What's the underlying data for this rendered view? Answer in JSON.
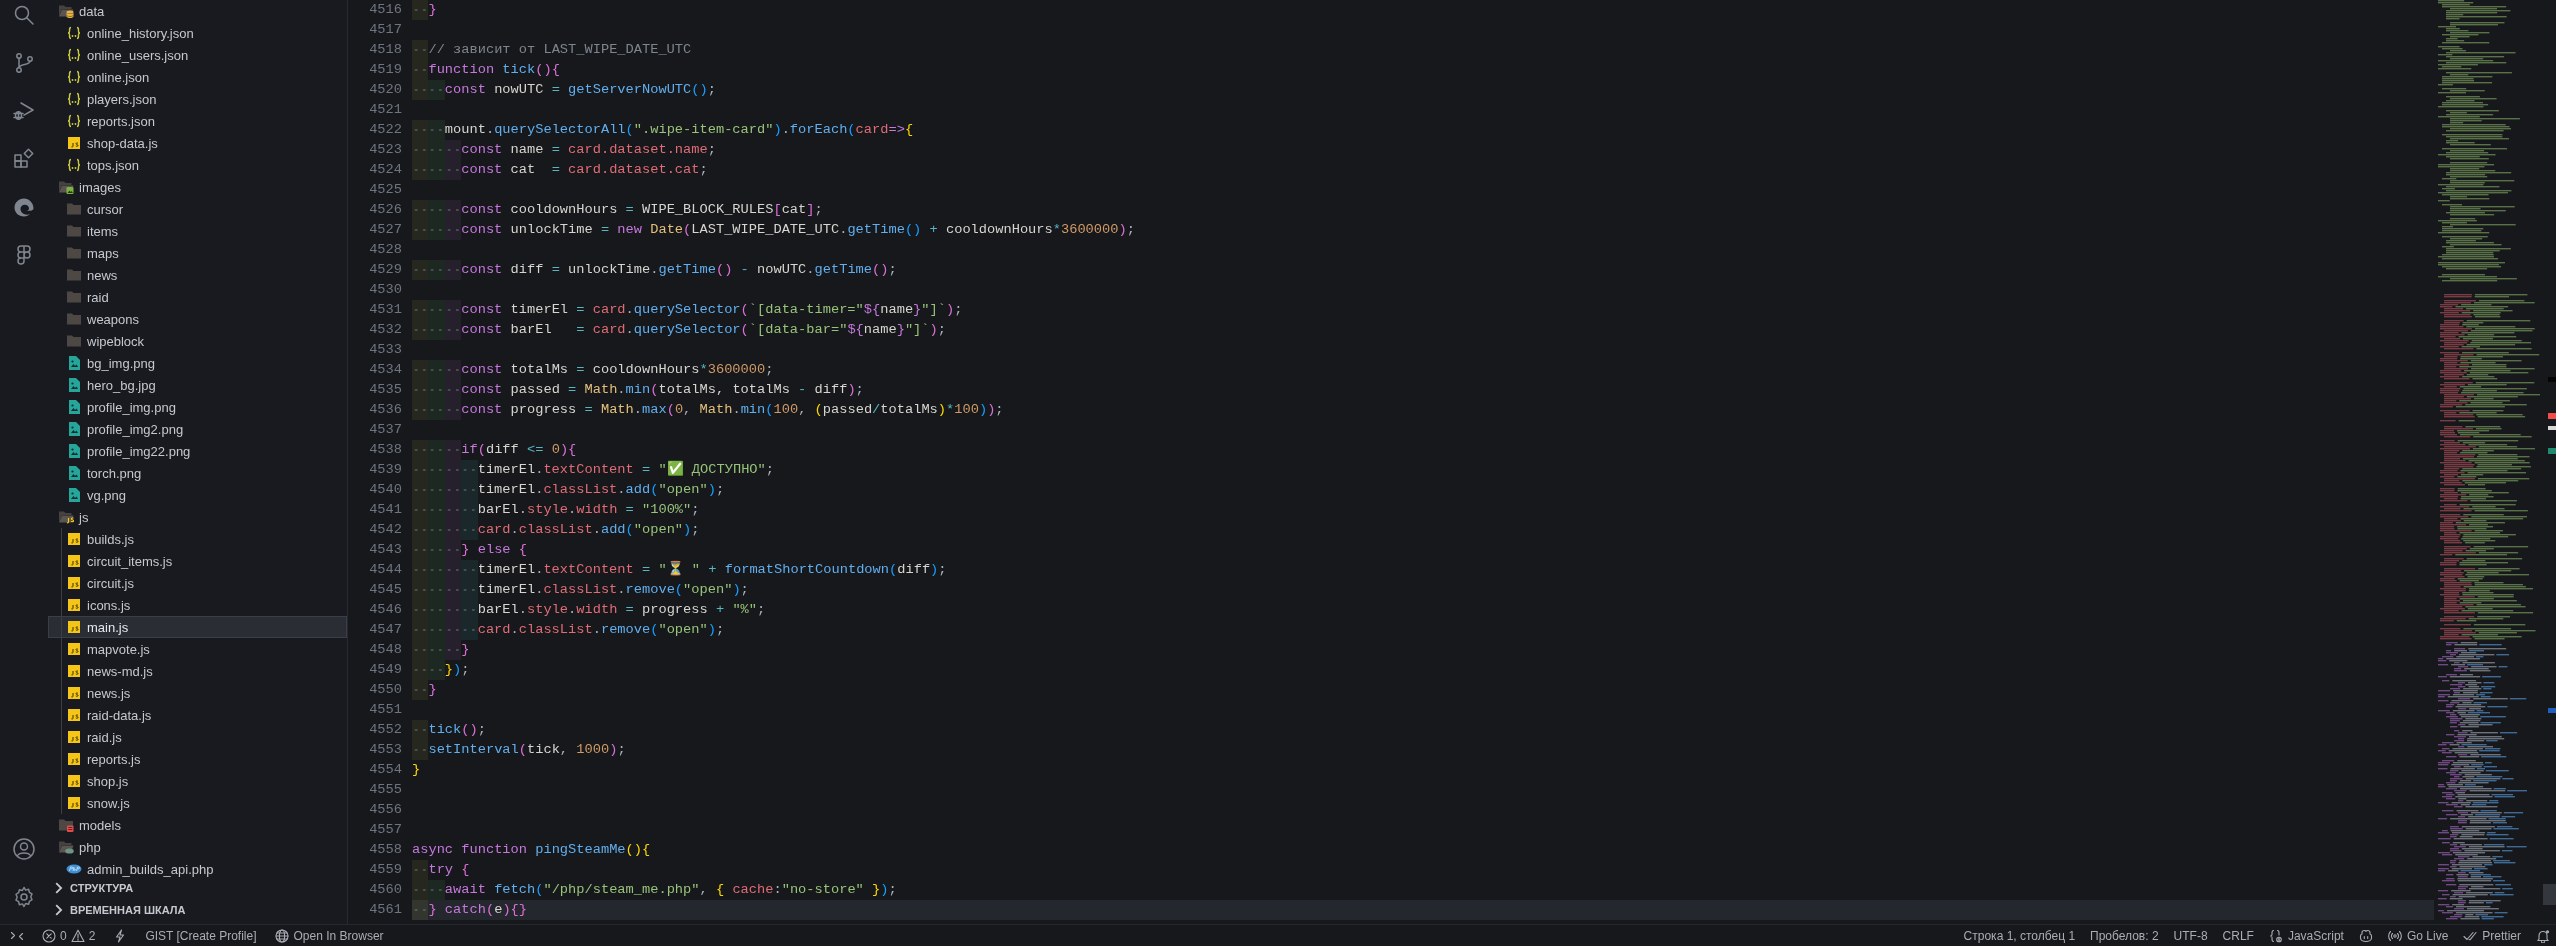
{
  "explorer": {
    "tree": [
      {
        "label": "data",
        "kind": "datafolder",
        "expanded": true,
        "selected": false,
        "children": [
          {
            "label": "online_history.json",
            "kind": "json",
            "selected": false
          },
          {
            "label": "online_users.json",
            "kind": "json",
            "selected": false
          },
          {
            "label": "online.json",
            "kind": "json",
            "selected": false
          },
          {
            "label": "players.json",
            "kind": "json",
            "selected": false
          },
          {
            "label": "reports.json",
            "kind": "json",
            "selected": false
          },
          {
            "label": "shop-data.js",
            "kind": "js",
            "selected": false
          },
          {
            "label": "tops.json",
            "kind": "json",
            "selected": false
          }
        ]
      },
      {
        "label": "images",
        "kind": "imagefolder",
        "expanded": true,
        "selected": false,
        "children": [
          {
            "label": "cursor",
            "kind": "folder",
            "expanded": false,
            "selected": false
          },
          {
            "label": "items",
            "kind": "folder",
            "expanded": false,
            "selected": false
          },
          {
            "label": "maps",
            "kind": "folder",
            "expanded": false,
            "selected": false
          },
          {
            "label": "news",
            "kind": "folder",
            "expanded": false,
            "selected": false
          },
          {
            "label": "raid",
            "kind": "folder",
            "expanded": false,
            "selected": false
          },
          {
            "label": "weapons",
            "kind": "folder",
            "expanded": false,
            "selected": false
          },
          {
            "label": "wipeblock",
            "kind": "folder",
            "expanded": false,
            "selected": false
          },
          {
            "label": "bg_img.png",
            "kind": "image",
            "selected": false
          },
          {
            "label": "hero_bg.jpg",
            "kind": "image",
            "selected": false
          },
          {
            "label": "profile_img.png",
            "kind": "image",
            "selected": false
          },
          {
            "label": "profile_img2.png",
            "kind": "image",
            "selected": false
          },
          {
            "label": "profile_img22.png",
            "kind": "image",
            "selected": false
          },
          {
            "label": "torch.png",
            "kind": "image",
            "selected": false
          },
          {
            "label": "vg.png",
            "kind": "image",
            "selected": false
          }
        ]
      },
      {
        "label": "js",
        "kind": "jsfolder",
        "expanded": true,
        "selected": false,
        "children": [
          {
            "label": "builds.js",
            "kind": "js",
            "selected": false
          },
          {
            "label": "circuit_items.js",
            "kind": "js",
            "selected": false
          },
          {
            "label": "circuit.js",
            "kind": "js",
            "selected": false
          },
          {
            "label": "icons.js",
            "kind": "js",
            "selected": false
          },
          {
            "label": "main.js",
            "kind": "js",
            "selected": true
          },
          {
            "label": "mapvote.js",
            "kind": "js",
            "selected": false
          },
          {
            "label": "news-md.js",
            "kind": "js",
            "selected": false
          },
          {
            "label": "news.js",
            "kind": "js",
            "selected": false
          },
          {
            "label": "raid-data.js",
            "kind": "js",
            "selected": false
          },
          {
            "label": "raid.js",
            "kind": "js",
            "selected": false
          },
          {
            "label": "reports.js",
            "kind": "js",
            "selected": false
          },
          {
            "label": "shop.js",
            "kind": "js",
            "selected": false
          },
          {
            "label": "snow.js",
            "kind": "js",
            "selected": false
          }
        ]
      },
      {
        "label": "models",
        "kind": "modelfolder",
        "expanded": false,
        "selected": false
      },
      {
        "label": "php",
        "kind": "phpfolder",
        "expanded": true,
        "selected": false,
        "children": [
          {
            "label": "admin_builds_api.php",
            "kind": "php",
            "selected": false
          }
        ]
      }
    ],
    "sections": [
      {
        "label": "СТРУКТУРА",
        "expanded": false
      },
      {
        "label": "ВРЕМЕННАЯ ШКАЛА",
        "expanded": false
      }
    ]
  },
  "editor": {
    "lines": [
      {
        "number": "4516",
        "current": false,
        "tokens": [
          {
            "kind": "brace2",
            "text": "  }"
          }
        ]
      },
      {
        "number": "4517",
        "current": false
      },
      {
        "number": "4518",
        "current": false,
        "tokens": [
          {
            "kind": "comment",
            "text": "  // зависит от LAST_WIPE_DATE_UTC"
          }
        ]
      },
      {
        "number": "4519",
        "current": false,
        "tokens": [
          {
            "kind": "keyword",
            "text": "  function "
          },
          {
            "kind": "function",
            "text": "tick"
          },
          {
            "kind": "brace2",
            "text": "(){"
          }
        ]
      },
      {
        "number": "4520",
        "current": false,
        "tokens": [
          {
            "kind": "keyword",
            "text": "    const "
          },
          {
            "kind": "variable",
            "text": "nowUTC "
          },
          {
            "kind": "operator",
            "text": "= "
          },
          {
            "kind": "function",
            "text": "getServerNowUTC"
          },
          {
            "kind": "brace3",
            "text": "()"
          },
          {
            "kind": "punctuation",
            "text": ";"
          }
        ]
      },
      {
        "number": "4521",
        "current": false
      },
      {
        "number": "4522",
        "current": false,
        "tokens": [
          {
            "kind": "variable",
            "text": "    mount"
          },
          {
            "kind": "punctuation",
            "text": "."
          },
          {
            "kind": "function",
            "text": "querySelectorAll"
          },
          {
            "kind": "brace3",
            "text": "("
          },
          {
            "kind": "string",
            "text": "\".wipe-item-card\""
          },
          {
            "kind": "brace3",
            "text": ")"
          },
          {
            "kind": "punctuation",
            "text": "."
          },
          {
            "kind": "function",
            "text": "forEach"
          },
          {
            "kind": "brace3",
            "text": "("
          },
          {
            "kind": "property",
            "text": "card"
          },
          {
            "kind": "keyword",
            "text": "=>"
          },
          {
            "kind": "brace1",
            "text": "{"
          }
        ]
      },
      {
        "number": "4523",
        "current": false,
        "tokens": [
          {
            "kind": "keyword",
            "text": "      const "
          },
          {
            "kind": "variable",
            "text": "name "
          },
          {
            "kind": "operator",
            "text": "= "
          },
          {
            "kind": "property",
            "text": "card.dataset.name"
          },
          {
            "kind": "punctuation",
            "text": ";"
          }
        ]
      },
      {
        "number": "4524",
        "current": false,
        "tokens": [
          {
            "kind": "keyword",
            "text": "      const "
          },
          {
            "kind": "variable",
            "text": "cat  "
          },
          {
            "kind": "operator",
            "text": "= "
          },
          {
            "kind": "property",
            "text": "card.dataset.cat"
          },
          {
            "kind": "punctuation",
            "text": ";"
          }
        ]
      },
      {
        "number": "4525",
        "current": false
      },
      {
        "number": "4526",
        "current": false,
        "tokens": [
          {
            "kind": "keyword",
            "text": "      const "
          },
          {
            "kind": "variable",
            "text": "cooldownHours "
          },
          {
            "kind": "operator",
            "text": "= "
          },
          {
            "kind": "variable",
            "text": "WIPE_BLOCK_RULES"
          },
          {
            "kind": "brace2",
            "text": "["
          },
          {
            "kind": "variable",
            "text": "cat"
          },
          {
            "kind": "brace2",
            "text": "]"
          },
          {
            "kind": "punctuation",
            "text": ";"
          }
        ]
      },
      {
        "number": "4527",
        "current": false,
        "tokens": [
          {
            "kind": "keyword",
            "text": "      const "
          },
          {
            "kind": "variable",
            "text": "unlockTime "
          },
          {
            "kind": "operator",
            "text": "= "
          },
          {
            "kind": "keyword",
            "text": "new "
          },
          {
            "kind": "type",
            "text": "Date"
          },
          {
            "kind": "brace2",
            "text": "("
          },
          {
            "kind": "variable",
            "text": "LAST_WIPE_DATE_UTC"
          },
          {
            "kind": "punctuation",
            "text": "."
          },
          {
            "kind": "function",
            "text": "getTime"
          },
          {
            "kind": "brace3",
            "text": "()"
          },
          {
            "kind": "operator",
            "text": " + "
          },
          {
            "kind": "variable",
            "text": "cooldownHours"
          },
          {
            "kind": "operator",
            "text": "*"
          },
          {
            "kind": "number",
            "text": "3600000"
          },
          {
            "kind": "brace2",
            "text": ")"
          },
          {
            "kind": "punctuation",
            "text": ";"
          }
        ]
      },
      {
        "number": "4528",
        "current": false
      },
      {
        "number": "4529",
        "current": false,
        "tokens": [
          {
            "kind": "keyword",
            "text": "      const "
          },
          {
            "kind": "variable",
            "text": "diff "
          },
          {
            "kind": "operator",
            "text": "= "
          },
          {
            "kind": "variable",
            "text": "unlockTime"
          },
          {
            "kind": "punctuation",
            "text": "."
          },
          {
            "kind": "function",
            "text": "getTime"
          },
          {
            "kind": "brace2",
            "text": "()"
          },
          {
            "kind": "operator",
            "text": " - "
          },
          {
            "kind": "variable",
            "text": "nowUTC"
          },
          {
            "kind": "punctuation",
            "text": "."
          },
          {
            "kind": "function",
            "text": "getTime"
          },
          {
            "kind": "brace2",
            "text": "()"
          },
          {
            "kind": "punctuation",
            "text": ";"
          }
        ]
      },
      {
        "number": "4530",
        "current": false
      },
      {
        "number": "4531",
        "current": false,
        "tokens": [
          {
            "kind": "keyword",
            "text": "      const "
          },
          {
            "kind": "variable",
            "text": "timerEl "
          },
          {
            "kind": "operator",
            "text": "= "
          },
          {
            "kind": "property",
            "text": "card"
          },
          {
            "kind": "punctuation",
            "text": "."
          },
          {
            "kind": "function",
            "text": "querySelector"
          },
          {
            "kind": "brace2",
            "text": "("
          },
          {
            "kind": "string",
            "text": "`[data-timer=\""
          },
          {
            "kind": "keyword",
            "text": "${"
          },
          {
            "kind": "variable",
            "text": "name"
          },
          {
            "kind": "keyword",
            "text": "}"
          },
          {
            "kind": "string",
            "text": "\"]`"
          },
          {
            "kind": "brace2",
            "text": ")"
          },
          {
            "kind": "punctuation",
            "text": ";"
          }
        ]
      },
      {
        "number": "4532",
        "current": false,
        "tokens": [
          {
            "kind": "keyword",
            "text": "      const "
          },
          {
            "kind": "variable",
            "text": "barEl   "
          },
          {
            "kind": "operator",
            "text": "= "
          },
          {
            "kind": "property",
            "text": "card"
          },
          {
            "kind": "punctuation",
            "text": "."
          },
          {
            "kind": "function",
            "text": "querySelector"
          },
          {
            "kind": "brace2",
            "text": "("
          },
          {
            "kind": "string",
            "text": "`[data-bar=\""
          },
          {
            "kind": "keyword",
            "text": "${"
          },
          {
            "kind": "variable",
            "text": "name"
          },
          {
            "kind": "keyword",
            "text": "}"
          },
          {
            "kind": "string",
            "text": "\"]`"
          },
          {
            "kind": "brace2",
            "text": ")"
          },
          {
            "kind": "punctuation",
            "text": ";"
          }
        ]
      },
      {
        "number": "4533",
        "current": false
      },
      {
        "number": "4534",
        "current": false,
        "tokens": [
          {
            "kind": "keyword",
            "text": "      const "
          },
          {
            "kind": "variable",
            "text": "totalMs "
          },
          {
            "kind": "operator",
            "text": "= "
          },
          {
            "kind": "variable",
            "text": "cooldownHours"
          },
          {
            "kind": "operator",
            "text": "*"
          },
          {
            "kind": "number",
            "text": "3600000"
          },
          {
            "kind": "punctuation",
            "text": ";"
          }
        ]
      },
      {
        "number": "4535",
        "current": false,
        "tokens": [
          {
            "kind": "keyword",
            "text": "      const "
          },
          {
            "kind": "variable",
            "text": "passed "
          },
          {
            "kind": "operator",
            "text": "= "
          },
          {
            "kind": "type",
            "text": "Math"
          },
          {
            "kind": "punctuation",
            "text": "."
          },
          {
            "kind": "function",
            "text": "min"
          },
          {
            "kind": "brace2",
            "text": "("
          },
          {
            "kind": "variable",
            "text": "totalMs, totalMs "
          },
          {
            "kind": "operator",
            "text": "- "
          },
          {
            "kind": "variable",
            "text": "diff"
          },
          {
            "kind": "brace2",
            "text": ")"
          },
          {
            "kind": "punctuation",
            "text": ";"
          }
        ]
      },
      {
        "number": "4536",
        "current": false,
        "tokens": [
          {
            "kind": "keyword",
            "text": "      const "
          },
          {
            "kind": "variable",
            "text": "progress "
          },
          {
            "kind": "operator",
            "text": "= "
          },
          {
            "kind": "type",
            "text": "Math"
          },
          {
            "kind": "punctuation",
            "text": "."
          },
          {
            "kind": "function",
            "text": "max"
          },
          {
            "kind": "brace2",
            "text": "("
          },
          {
            "kind": "number",
            "text": "0"
          },
          {
            "kind": "punctuation",
            "text": ", "
          },
          {
            "kind": "type",
            "text": "Math"
          },
          {
            "kind": "punctuation",
            "text": "."
          },
          {
            "kind": "function",
            "text": "min"
          },
          {
            "kind": "brace3",
            "text": "("
          },
          {
            "kind": "number",
            "text": "100"
          },
          {
            "kind": "punctuation",
            "text": ", "
          },
          {
            "kind": "brace1",
            "text": "("
          },
          {
            "kind": "variable",
            "text": "passed"
          },
          {
            "kind": "operator",
            "text": "/"
          },
          {
            "kind": "variable",
            "text": "totalMs"
          },
          {
            "kind": "brace1",
            "text": ")"
          },
          {
            "kind": "operator",
            "text": "*"
          },
          {
            "kind": "number",
            "text": "100"
          },
          {
            "kind": "brace3",
            "text": ")"
          },
          {
            "kind": "brace2",
            "text": ")"
          },
          {
            "kind": "punctuation",
            "text": ";"
          }
        ]
      },
      {
        "number": "4537",
        "current": false
      },
      {
        "number": "4538",
        "current": false,
        "tokens": [
          {
            "kind": "keyword",
            "text": "      if"
          },
          {
            "kind": "brace2",
            "text": "("
          },
          {
            "kind": "variable",
            "text": "diff "
          },
          {
            "kind": "operator",
            "text": "<= "
          },
          {
            "kind": "number",
            "text": "0"
          },
          {
            "kind": "brace2",
            "text": "){"
          }
        ]
      },
      {
        "number": "4539",
        "current": false,
        "tokens": [
          {
            "kind": "variable",
            "text": "        timerEl"
          },
          {
            "kind": "punctuation",
            "text": "."
          },
          {
            "kind": "property",
            "text": "textContent "
          },
          {
            "kind": "operator",
            "text": "= "
          },
          {
            "kind": "string",
            "text": "\"✅ ДОСТУПНО\""
          },
          {
            "kind": "punctuation",
            "text": ";"
          }
        ]
      },
      {
        "number": "4540",
        "current": false,
        "tokens": [
          {
            "kind": "variable",
            "text": "        timerEl"
          },
          {
            "kind": "punctuation",
            "text": "."
          },
          {
            "kind": "property",
            "text": "classList"
          },
          {
            "kind": "punctuation",
            "text": "."
          },
          {
            "kind": "function",
            "text": "add"
          },
          {
            "kind": "brace3",
            "text": "("
          },
          {
            "kind": "string",
            "text": "\"open\""
          },
          {
            "kind": "brace3",
            "text": ")"
          },
          {
            "kind": "punctuation",
            "text": ";"
          }
        ]
      },
      {
        "number": "4541",
        "current": false,
        "tokens": [
          {
            "kind": "variable",
            "text": "        barEl"
          },
          {
            "kind": "punctuation",
            "text": "."
          },
          {
            "kind": "property",
            "text": "style"
          },
          {
            "kind": "punctuation",
            "text": "."
          },
          {
            "kind": "property",
            "text": "width "
          },
          {
            "kind": "operator",
            "text": "= "
          },
          {
            "kind": "string",
            "text": "\"100%\""
          },
          {
            "kind": "punctuation",
            "text": ";"
          }
        ]
      },
      {
        "number": "4542",
        "current": false,
        "tokens": [
          {
            "kind": "property",
            "text": "        card"
          },
          {
            "kind": "punctuation",
            "text": "."
          },
          {
            "kind": "property",
            "text": "classList"
          },
          {
            "kind": "punctuation",
            "text": "."
          },
          {
            "kind": "function",
            "text": "add"
          },
          {
            "kind": "brace3",
            "text": "("
          },
          {
            "kind": "string",
            "text": "\"open\""
          },
          {
            "kind": "brace3",
            "text": ")"
          },
          {
            "kind": "punctuation",
            "text": ";"
          }
        ]
      },
      {
        "number": "4543",
        "current": false,
        "tokens": [
          {
            "kind": "brace2",
            "text": "      } "
          },
          {
            "kind": "keyword",
            "text": "else "
          },
          {
            "kind": "brace2",
            "text": "{"
          }
        ]
      },
      {
        "number": "4544",
        "current": false,
        "tokens": [
          {
            "kind": "variable",
            "text": "        timerEl"
          },
          {
            "kind": "punctuation",
            "text": "."
          },
          {
            "kind": "property",
            "text": "textContent "
          },
          {
            "kind": "operator",
            "text": "= "
          },
          {
            "kind": "string",
            "text": "\"⏳ \""
          },
          {
            "kind": "operator",
            "text": " + "
          },
          {
            "kind": "function",
            "text": "formatShortCountdown"
          },
          {
            "kind": "brace3",
            "text": "("
          },
          {
            "kind": "variable",
            "text": "diff"
          },
          {
            "kind": "brace3",
            "text": ")"
          },
          {
            "kind": "punctuation",
            "text": ";"
          }
        ]
      },
      {
        "number": "4545",
        "current": false,
        "tokens": [
          {
            "kind": "variable",
            "text": "        timerEl"
          },
          {
            "kind": "punctuation",
            "text": "."
          },
          {
            "kind": "property",
            "text": "classList"
          },
          {
            "kind": "punctuation",
            "text": "."
          },
          {
            "kind": "function",
            "text": "remove"
          },
          {
            "kind": "brace3",
            "text": "("
          },
          {
            "kind": "string",
            "text": "\"open\""
          },
          {
            "kind": "brace3",
            "text": ")"
          },
          {
            "kind": "punctuation",
            "text": ";"
          }
        ]
      },
      {
        "number": "4546",
        "current": false,
        "tokens": [
          {
            "kind": "variable",
            "text": "        barEl"
          },
          {
            "kind": "punctuation",
            "text": "."
          },
          {
            "kind": "property",
            "text": "style"
          },
          {
            "kind": "punctuation",
            "text": "."
          },
          {
            "kind": "property",
            "text": "width "
          },
          {
            "kind": "operator",
            "text": "= "
          },
          {
            "kind": "variable",
            "text": "progress "
          },
          {
            "kind": "operator",
            "text": "+ "
          },
          {
            "kind": "string",
            "text": "\"%\""
          },
          {
            "kind": "punctuation",
            "text": ";"
          }
        ]
      },
      {
        "number": "4547",
        "current": false,
        "tokens": [
          {
            "kind": "property",
            "text": "        card"
          },
          {
            "kind": "punctuation",
            "text": "."
          },
          {
            "kind": "property",
            "text": "classList"
          },
          {
            "kind": "punctuation",
            "text": "."
          },
          {
            "kind": "function",
            "text": "remove"
          },
          {
            "kind": "brace3",
            "text": "("
          },
          {
            "kind": "string",
            "text": "\"open\""
          },
          {
            "kind": "brace3",
            "text": ")"
          },
          {
            "kind": "punctuation",
            "text": ";"
          }
        ]
      },
      {
        "number": "4548",
        "current": false,
        "tokens": [
          {
            "kind": "brace2",
            "text": "      }"
          }
        ]
      },
      {
        "number": "4549",
        "current": false,
        "tokens": [
          {
            "kind": "brace1",
            "text": "    }"
          },
          {
            "kind": "brace3",
            "text": ")"
          },
          {
            "kind": "punctuation",
            "text": ";"
          }
        ]
      },
      {
        "number": "4550",
        "current": false,
        "tokens": [
          {
            "kind": "brace2",
            "text": "  }"
          }
        ]
      },
      {
        "number": "4551",
        "current": false
      },
      {
        "number": "4552",
        "current": false,
        "tokens": [
          {
            "kind": "function",
            "text": "  tick"
          },
          {
            "kind": "brace2",
            "text": "()"
          },
          {
            "kind": "punctuation",
            "text": ";"
          }
        ]
      },
      {
        "number": "4553",
        "current": false,
        "tokens": [
          {
            "kind": "function",
            "text": "  setInterval"
          },
          {
            "kind": "brace2",
            "text": "("
          },
          {
            "kind": "variable",
            "text": "tick"
          },
          {
            "kind": "punctuation",
            "text": ", "
          },
          {
            "kind": "number",
            "text": "1000"
          },
          {
            "kind": "brace2",
            "text": ")"
          },
          {
            "kind": "punctuation",
            "text": ";"
          }
        ]
      },
      {
        "number": "4554",
        "current": false,
        "tokens": [
          {
            "kind": "brace1",
            "text": "}"
          }
        ]
      },
      {
        "number": "4555",
        "current": false
      },
      {
        "number": "4556",
        "current": false
      },
      {
        "number": "4557",
        "current": false
      },
      {
        "number": "4558",
        "current": false,
        "tokens": [
          {
            "kind": "keyword",
            "text": "async function "
          },
          {
            "kind": "function",
            "text": "pingSteamMe"
          },
          {
            "kind": "brace1",
            "text": "(){"
          }
        ]
      },
      {
        "number": "4559",
        "current": false,
        "tokens": [
          {
            "kind": "keyword",
            "text": "  try "
          },
          {
            "kind": "brace2",
            "text": "{"
          }
        ]
      },
      {
        "number": "4560",
        "current": false,
        "tokens": [
          {
            "kind": "keyword",
            "text": "    await "
          },
          {
            "kind": "function",
            "text": "fetch"
          },
          {
            "kind": "brace3",
            "text": "("
          },
          {
            "kind": "string",
            "text": "\"/php/steam_me.php\""
          },
          {
            "kind": "punctuation",
            "text": ", "
          },
          {
            "kind": "brace1",
            "text": "{ "
          },
          {
            "kind": "property",
            "text": "cache"
          },
          {
            "kind": "punctuation",
            "text": ":"
          },
          {
            "kind": "string",
            "text": "\"no-store\""
          },
          {
            "kind": "brace1",
            "text": " }"
          },
          {
            "kind": "brace3",
            "text": ")"
          },
          {
            "kind": "punctuation",
            "text": ";"
          }
        ]
      },
      {
        "number": "4561",
        "current": true,
        "tokens": [
          {
            "kind": "brace2",
            "text": "  } "
          },
          {
            "kind": "keyword",
            "text": "catch"
          },
          {
            "kind": "brace2",
            "text": "("
          },
          {
            "kind": "variable",
            "text": "e"
          },
          {
            "kind": "brace2",
            "text": "){}"
          }
        ]
      }
    ]
  },
  "status_bar": {
    "errors": "0",
    "warnings": "2",
    "gist": "GIST [Create Profile]",
    "open_in_browser": "Open In Browser",
    "cursor_position": "Строка 1, столбец 1",
    "indentation": "Пробелов: 2",
    "encoding": "UTF-8",
    "line_endings": "CRLF",
    "language": "JavaScript",
    "live_server": "Go Live",
    "formatter": "Prettier"
  }
}
